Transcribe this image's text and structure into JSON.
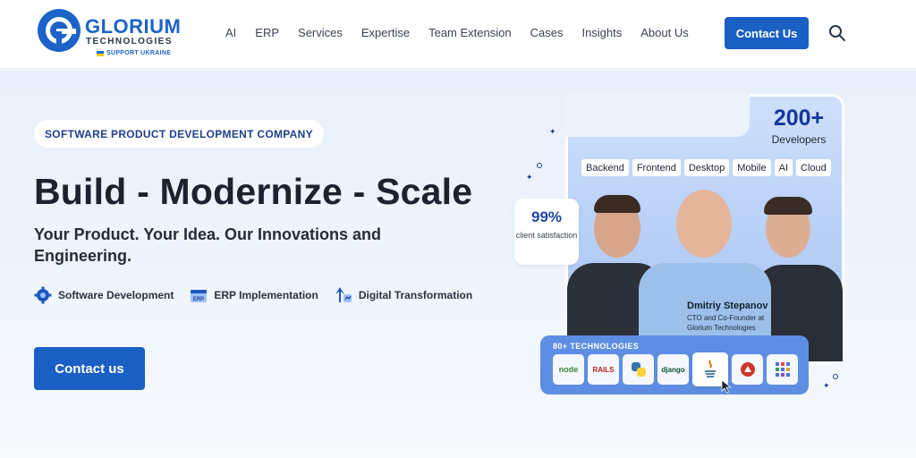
{
  "brand": {
    "name": "GLORIUM",
    "sub": "TECHNOLOGIES",
    "tagline": "SUPPORT UKRAINE",
    "colors": {
      "primary": "#1a5fc3",
      "logo": "#1c63c8",
      "heading": "#1b2230",
      "badge_text": "#1f3f8e"
    }
  },
  "nav": {
    "items": [
      "AI",
      "ERP",
      "Services",
      "Expertise",
      "Team Extension",
      "Cases",
      "Insights",
      "About Us"
    ],
    "cta": "Contact Us",
    "search_icon": "search-icon"
  },
  "hero": {
    "badge": "SOFTWARE PRODUCT DEVELOPMENT COMPANY",
    "title": "Build - Modernize - Scale",
    "subtitle": "Your Product. Your Idea. Our Innovations and Engineering.",
    "features": [
      {
        "icon": "gear-icon",
        "label": "Software Development"
      },
      {
        "icon": "erp-icon",
        "label": "ERP Implementation"
      },
      {
        "icon": "transformation-icon",
        "label": "Digital Transformation"
      }
    ],
    "cta": "Contact us"
  },
  "visual": {
    "developers_count": "200+",
    "developers_label": "Developers",
    "skills": [
      "Backend",
      "Frontend",
      "Desktop",
      "Mobile",
      "AI",
      "Cloud"
    ],
    "satisfaction_value": "99%",
    "satisfaction_label": "client satisfaction",
    "person_name": "Dmitriy Stepanov",
    "person_role": "CTO and Co-Founder at Glorium Technologies",
    "tech_title": "80+ TECHNOLOGIES",
    "tech_tiles": [
      {
        "icon": "nodejs-logo",
        "label": "node"
      },
      {
        "icon": "rails-logo",
        "label": "RAILS"
      },
      {
        "icon": "python-logo",
        "label": ""
      },
      {
        "icon": "django-logo",
        "label": "django"
      },
      {
        "icon": "java-logo",
        "label": ""
      },
      {
        "icon": "ruby-logo",
        "label": ""
      },
      {
        "icon": "apps-grid-logo",
        "label": ""
      }
    ]
  }
}
